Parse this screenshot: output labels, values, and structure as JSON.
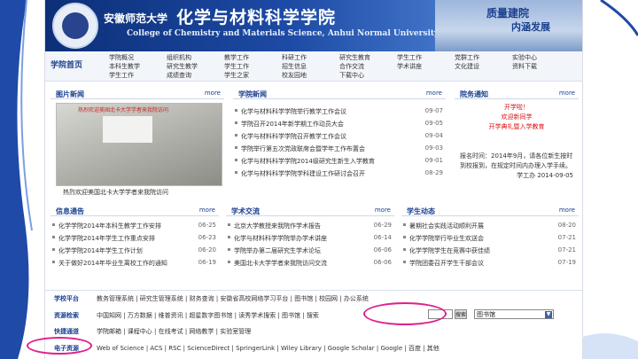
{
  "header": {
    "school_name": "安徽师范大学",
    "college_cn": "化学与材料科学学院",
    "college_en": "College of Chemistry and Materials Science, Anhui Normal University",
    "slogan_1": "质量建院",
    "slogan_2": "内涵发展"
  },
  "nav": {
    "home": "学院首页",
    "items": [
      "学院概况",
      "组织机构",
      "教学工作",
      "科研工作",
      "研究生教育",
      "学生工作",
      "党群工作",
      "实验中心",
      "本科生教学",
      "研究生教学",
      "学生工作",
      "招生信息",
      "合作交流",
      "学术讲座",
      "文化建设",
      "资料下载",
      "学生工作",
      "成绩查询",
      "学生之家",
      "校友园地",
      "下载中心",
      "",
      "",
      ""
    ]
  },
  "photo_news": {
    "title": "图片新闻",
    "more": "more",
    "overlay_text": "热烈欢迎美国北卡大学学者来我院访问",
    "caption": "热烈欢迎美国北卡大学学者来我院访问"
  },
  "college_news": {
    "title": "学院新闻",
    "more": "more",
    "items": [
      {
        "title": "化学与材料科学学院举行教学工作会议",
        "date": "09-07"
      },
      {
        "title": "学院召开2014年新学期工作动员大会",
        "date": "09-05"
      },
      {
        "title": "化学与材料科学学院召开教学工作会议",
        "date": "09-04"
      },
      {
        "title": "学院举行第五次党政联席会暨学年工作布置会",
        "date": "09-03"
      },
      {
        "title": "化学与材料科学学院2014级研究生新生入学教育",
        "date": "09-01"
      },
      {
        "title": "化学与材料科学学院学科建设工作研讨会召开",
        "date": "08-29"
      }
    ]
  },
  "notices": {
    "title": "院务通知",
    "more": "more",
    "red_title": "开学啦！",
    "red_lines": [
      "欢迎新同学",
      "开学典礼暨入学教育"
    ],
    "body": [
      "报名时间：2014年9月，请各位新生按时到校报到，在规定时间内办理入学手续。"
    ],
    "sign": "学工办 2014-09-05"
  },
  "info_bulletin": {
    "title": "信息通告",
    "more": "more",
    "items": [
      {
        "title": "化学学院2014年本科生教学工作安排",
        "date": "06-25"
      },
      {
        "title": "化学学院2014年学生工作重点安排",
        "date": "06-23"
      },
      {
        "title": "化学学院2014年学生工作计划",
        "date": "06-20"
      },
      {
        "title": "关于做好2014年毕业生离校工作的通知",
        "date": "06-19"
      }
    ]
  },
  "academic_exchange": {
    "title": "学术交流",
    "more": "more",
    "items": [
      {
        "title": "北京大学教授来我院作学术报告",
        "date": "06-29"
      },
      {
        "title": "化学与材料科学学院举办学术讲座",
        "date": "06-14"
      },
      {
        "title": "学院举办第二届研究生学术论坛",
        "date": "06-06"
      },
      {
        "title": "美国北卡大学学者来我院访问交流",
        "date": "06-06"
      }
    ]
  },
  "student_work": {
    "title": "学生动态",
    "more": "more",
    "items": [
      {
        "title": "暑期社会实践活动顺利开展",
        "date": "08-20"
      },
      {
        "title": "化学学院举行毕业生欢送会",
        "date": "07-21"
      },
      {
        "title": "化学学院学生在竞赛中获佳绩",
        "date": "07-21"
      },
      {
        "title": "学院团委召开学生干部会议",
        "date": "07-19"
      }
    ]
  },
  "link_rows": [
    {
      "label": "学校平台",
      "items": "教务管理系统 | 研究生管理系统 | 财务查询 | 安徽省高校网络学习平台 | 图书馆 | 校园网 | 办公系统"
    },
    {
      "label": "资源检索",
      "items": "中国知网 | 万方数据 | 维普资讯 | 超星数字图书馆 | 读秀学术搜索 | 图书馆 | 搜索"
    },
    {
      "label": "快捷通道",
      "items": "学院邮箱 | 课程中心 | 在线考试 | 网络教学 | 实验室管理"
    },
    {
      "label": "电子资源",
      "items": "Web of Science | ACS | RSC | ScienceDirect | SpringerLink | Wiley Library | Google Scholar | Google | 百度 | 其他"
    }
  ],
  "search": {
    "go": "搜索",
    "select_value": "图书馆"
  }
}
